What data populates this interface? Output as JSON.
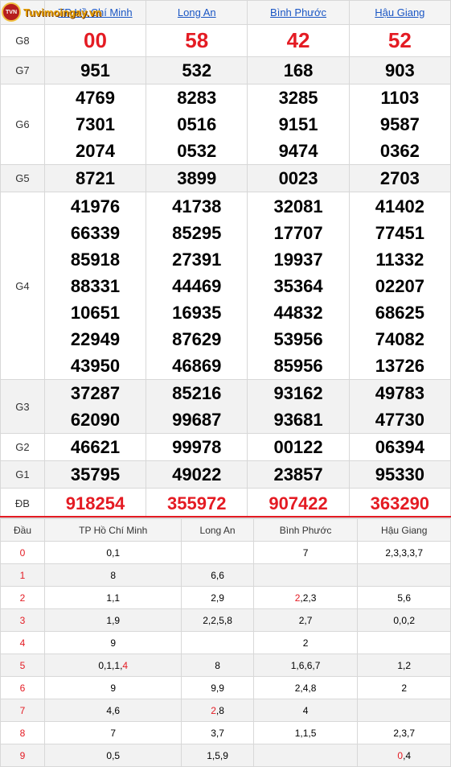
{
  "logo": {
    "text": "Tuvimoingay.vn",
    "mark": "TVN"
  },
  "provinces": [
    "TP Hồ Chí Minh",
    "Long An",
    "Bình Phước",
    "Hậu Giang"
  ],
  "prizes": [
    {
      "label": "G8",
      "values": [
        [
          "00"
        ],
        [
          "58"
        ],
        [
          "42"
        ],
        [
          "52"
        ]
      ]
    },
    {
      "label": "G7",
      "values": [
        [
          "951"
        ],
        [
          "532"
        ],
        [
          "168"
        ],
        [
          "903"
        ]
      ]
    },
    {
      "label": "G6",
      "values": [
        [
          "4769",
          "7301",
          "2074"
        ],
        [
          "8283",
          "0516",
          "0532"
        ],
        [
          "3285",
          "9151",
          "9474"
        ],
        [
          "1103",
          "9587",
          "0362"
        ]
      ]
    },
    {
      "label": "G5",
      "values": [
        [
          "8721"
        ],
        [
          "3899"
        ],
        [
          "0023"
        ],
        [
          "2703"
        ]
      ]
    },
    {
      "label": "G4",
      "values": [
        [
          "41976",
          "66339",
          "85918",
          "88331",
          "10651",
          "22949",
          "43950"
        ],
        [
          "41738",
          "85295",
          "27391",
          "44469",
          "16935",
          "87629",
          "46869"
        ],
        [
          "32081",
          "17707",
          "19937",
          "35364",
          "44832",
          "53956",
          "85956"
        ],
        [
          "41402",
          "77451",
          "11332",
          "02207",
          "68625",
          "74082",
          "13726"
        ]
      ]
    },
    {
      "label": "G3",
      "values": [
        [
          "37287",
          "62090"
        ],
        [
          "85216",
          "99687"
        ],
        [
          "93162",
          "93681"
        ],
        [
          "49783",
          "47730"
        ]
      ]
    },
    {
      "label": "G2",
      "values": [
        [
          "46621"
        ],
        [
          "99978"
        ],
        [
          "00122"
        ],
        [
          "06394"
        ]
      ]
    },
    {
      "label": "G1",
      "values": [
        [
          "35795"
        ],
        [
          "49022"
        ],
        [
          "23857"
        ],
        [
          "95330"
        ]
      ]
    },
    {
      "label": "ĐB",
      "values": [
        [
          "918254"
        ],
        [
          "355972"
        ],
        [
          "907422"
        ],
        [
          "363290"
        ]
      ]
    }
  ],
  "heads_table": {
    "title": "Đầu",
    "rows": [
      {
        "dau": "0",
        "cells": [
          [
            [
              "0,1",
              false
            ]
          ],
          [],
          [
            [
              "7",
              false
            ]
          ],
          [
            [
              "2,3,3,3,7",
              false
            ]
          ]
        ]
      },
      {
        "dau": "1",
        "cells": [
          [
            [
              "8",
              false
            ]
          ],
          [
            [
              "6,6",
              false
            ]
          ],
          [],
          []
        ]
      },
      {
        "dau": "2",
        "cells": [
          [
            [
              "1,1",
              false
            ]
          ],
          [
            [
              "2,9",
              false
            ]
          ],
          [
            [
              "2",
              true
            ],
            [
              ",2,3",
              false
            ]
          ],
          [
            [
              "5,6",
              false
            ]
          ]
        ]
      },
      {
        "dau": "3",
        "cells": [
          [
            [
              "1,9",
              false
            ]
          ],
          [
            [
              "2,2,5,8",
              false
            ]
          ],
          [
            [
              "2,7",
              false
            ]
          ],
          [
            [
              "0,0,2",
              false
            ]
          ]
        ]
      },
      {
        "dau": "4",
        "cells": [
          [
            [
              "9",
              false
            ]
          ],
          [],
          [
            [
              "2",
              false
            ]
          ],
          []
        ]
      },
      {
        "dau": "5",
        "cells": [
          [
            [
              "0,1,1,",
              false
            ],
            [
              "4",
              true
            ]
          ],
          [
            [
              "8",
              false
            ]
          ],
          [
            [
              "1,6,6,7",
              false
            ]
          ],
          [
            [
              "1,2",
              false
            ]
          ]
        ]
      },
      {
        "dau": "6",
        "cells": [
          [
            [
              "9",
              false
            ]
          ],
          [
            [
              "9,9",
              false
            ]
          ],
          [
            [
              "2,4,8",
              false
            ]
          ],
          [
            [
              "2",
              false
            ]
          ]
        ]
      },
      {
        "dau": "7",
        "cells": [
          [
            [
              "4,6",
              false
            ]
          ],
          [
            [
              "2",
              true
            ],
            [
              ",8",
              false
            ]
          ],
          [
            [
              "4",
              false
            ]
          ],
          []
        ]
      },
      {
        "dau": "8",
        "cells": [
          [
            [
              "7",
              false
            ]
          ],
          [
            [
              "3,7",
              false
            ]
          ],
          [
            [
              "1,1,5",
              false
            ]
          ],
          [
            [
              "2,3,7",
              false
            ]
          ]
        ]
      },
      {
        "dau": "9",
        "cells": [
          [
            [
              "0,5",
              false
            ]
          ],
          [
            [
              "1,5,9",
              false
            ]
          ],
          [],
          [
            [
              "0",
              true
            ],
            [
              ",4",
              false
            ]
          ]
        ]
      }
    ]
  },
  "colors": {
    "accent_red": "#e41b23",
    "link_blue": "#1a56c4",
    "row_gray": "#f2f2f2"
  }
}
